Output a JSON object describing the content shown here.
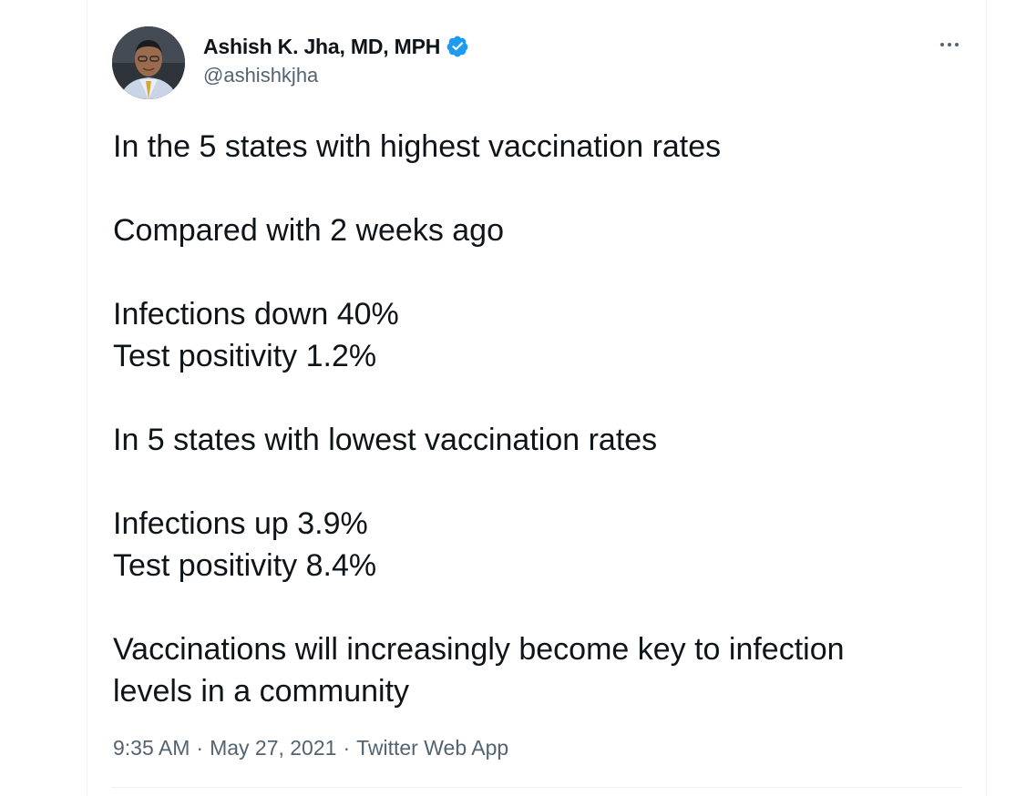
{
  "author": {
    "display_name": "Ashish K. Jha, MD, MPH",
    "handle": "@ashishkjha",
    "verified_icon": "verified-badge-icon",
    "verified_color": "#1d9bf0"
  },
  "tweet": {
    "lines": [
      "In the 5 states with highest vaccination rates",
      "",
      "Compared with 2 weeks ago",
      "",
      "Infections down 40%",
      "Test positivity 1.2%",
      "",
      "In 5 states with lowest vaccination rates",
      "",
      "Infections up 3.9%",
      "Test positivity 8.4%",
      "",
      "Vaccinations will increasingly become key to infection",
      "levels in a community"
    ]
  },
  "meta": {
    "time": "9:35 AM",
    "date": "May 27, 2021",
    "source": "Twitter Web App",
    "separator": "·"
  },
  "icons": {
    "more": "more-options-icon"
  }
}
